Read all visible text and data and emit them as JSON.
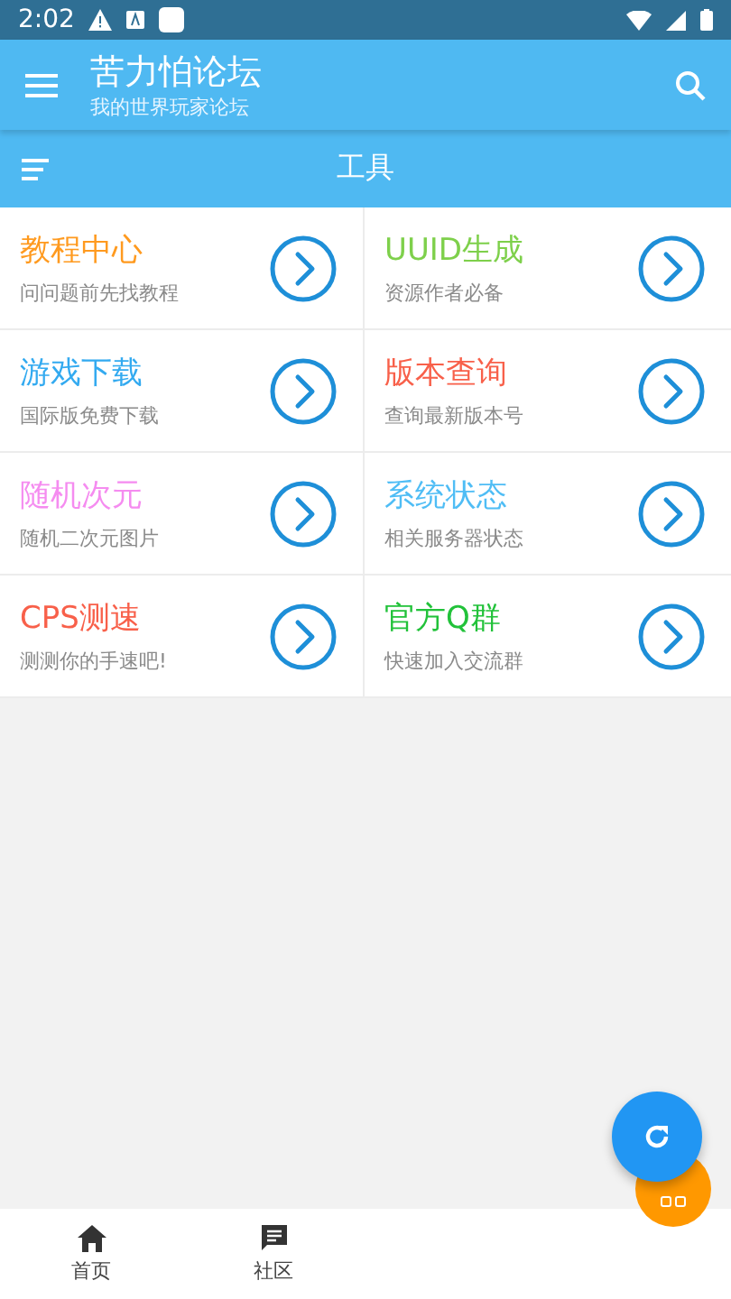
{
  "status_bar": {
    "time": "2:02"
  },
  "app_bar": {
    "title": "苦力怕论坛",
    "subtitle": "我的世界玩家论坛"
  },
  "section_header": {
    "title": "工具"
  },
  "tools": [
    {
      "title": "教程中心",
      "subtitle": "问问题前先找教程",
      "color": "#ff9a1f"
    },
    {
      "title": "UUID生成",
      "subtitle": "资源作者必备",
      "color": "#7ed04b"
    },
    {
      "title": "游戏下载",
      "subtitle": "国际版免费下载",
      "color": "#33aaf0"
    },
    {
      "title": "版本查询",
      "subtitle": "查询最新版本号",
      "color": "#f8604a"
    },
    {
      "title": "随机次元",
      "subtitle": "随机二次元图片",
      "color": "#f58cf0"
    },
    {
      "title": "系统状态",
      "subtitle": "相关服务器状态",
      "color": "#4fbdf5"
    },
    {
      "title": "CPS测速",
      "subtitle": "测测你的手速吧!",
      "color": "#f8604a"
    },
    {
      "title": "官方Q群",
      "subtitle": "快速加入交流群",
      "color": "#22c23a"
    }
  ],
  "bottom_nav": [
    {
      "label": "首页",
      "kind": "home",
      "selected": false
    },
    {
      "label": "社区",
      "kind": "chat",
      "selected": false
    }
  ]
}
